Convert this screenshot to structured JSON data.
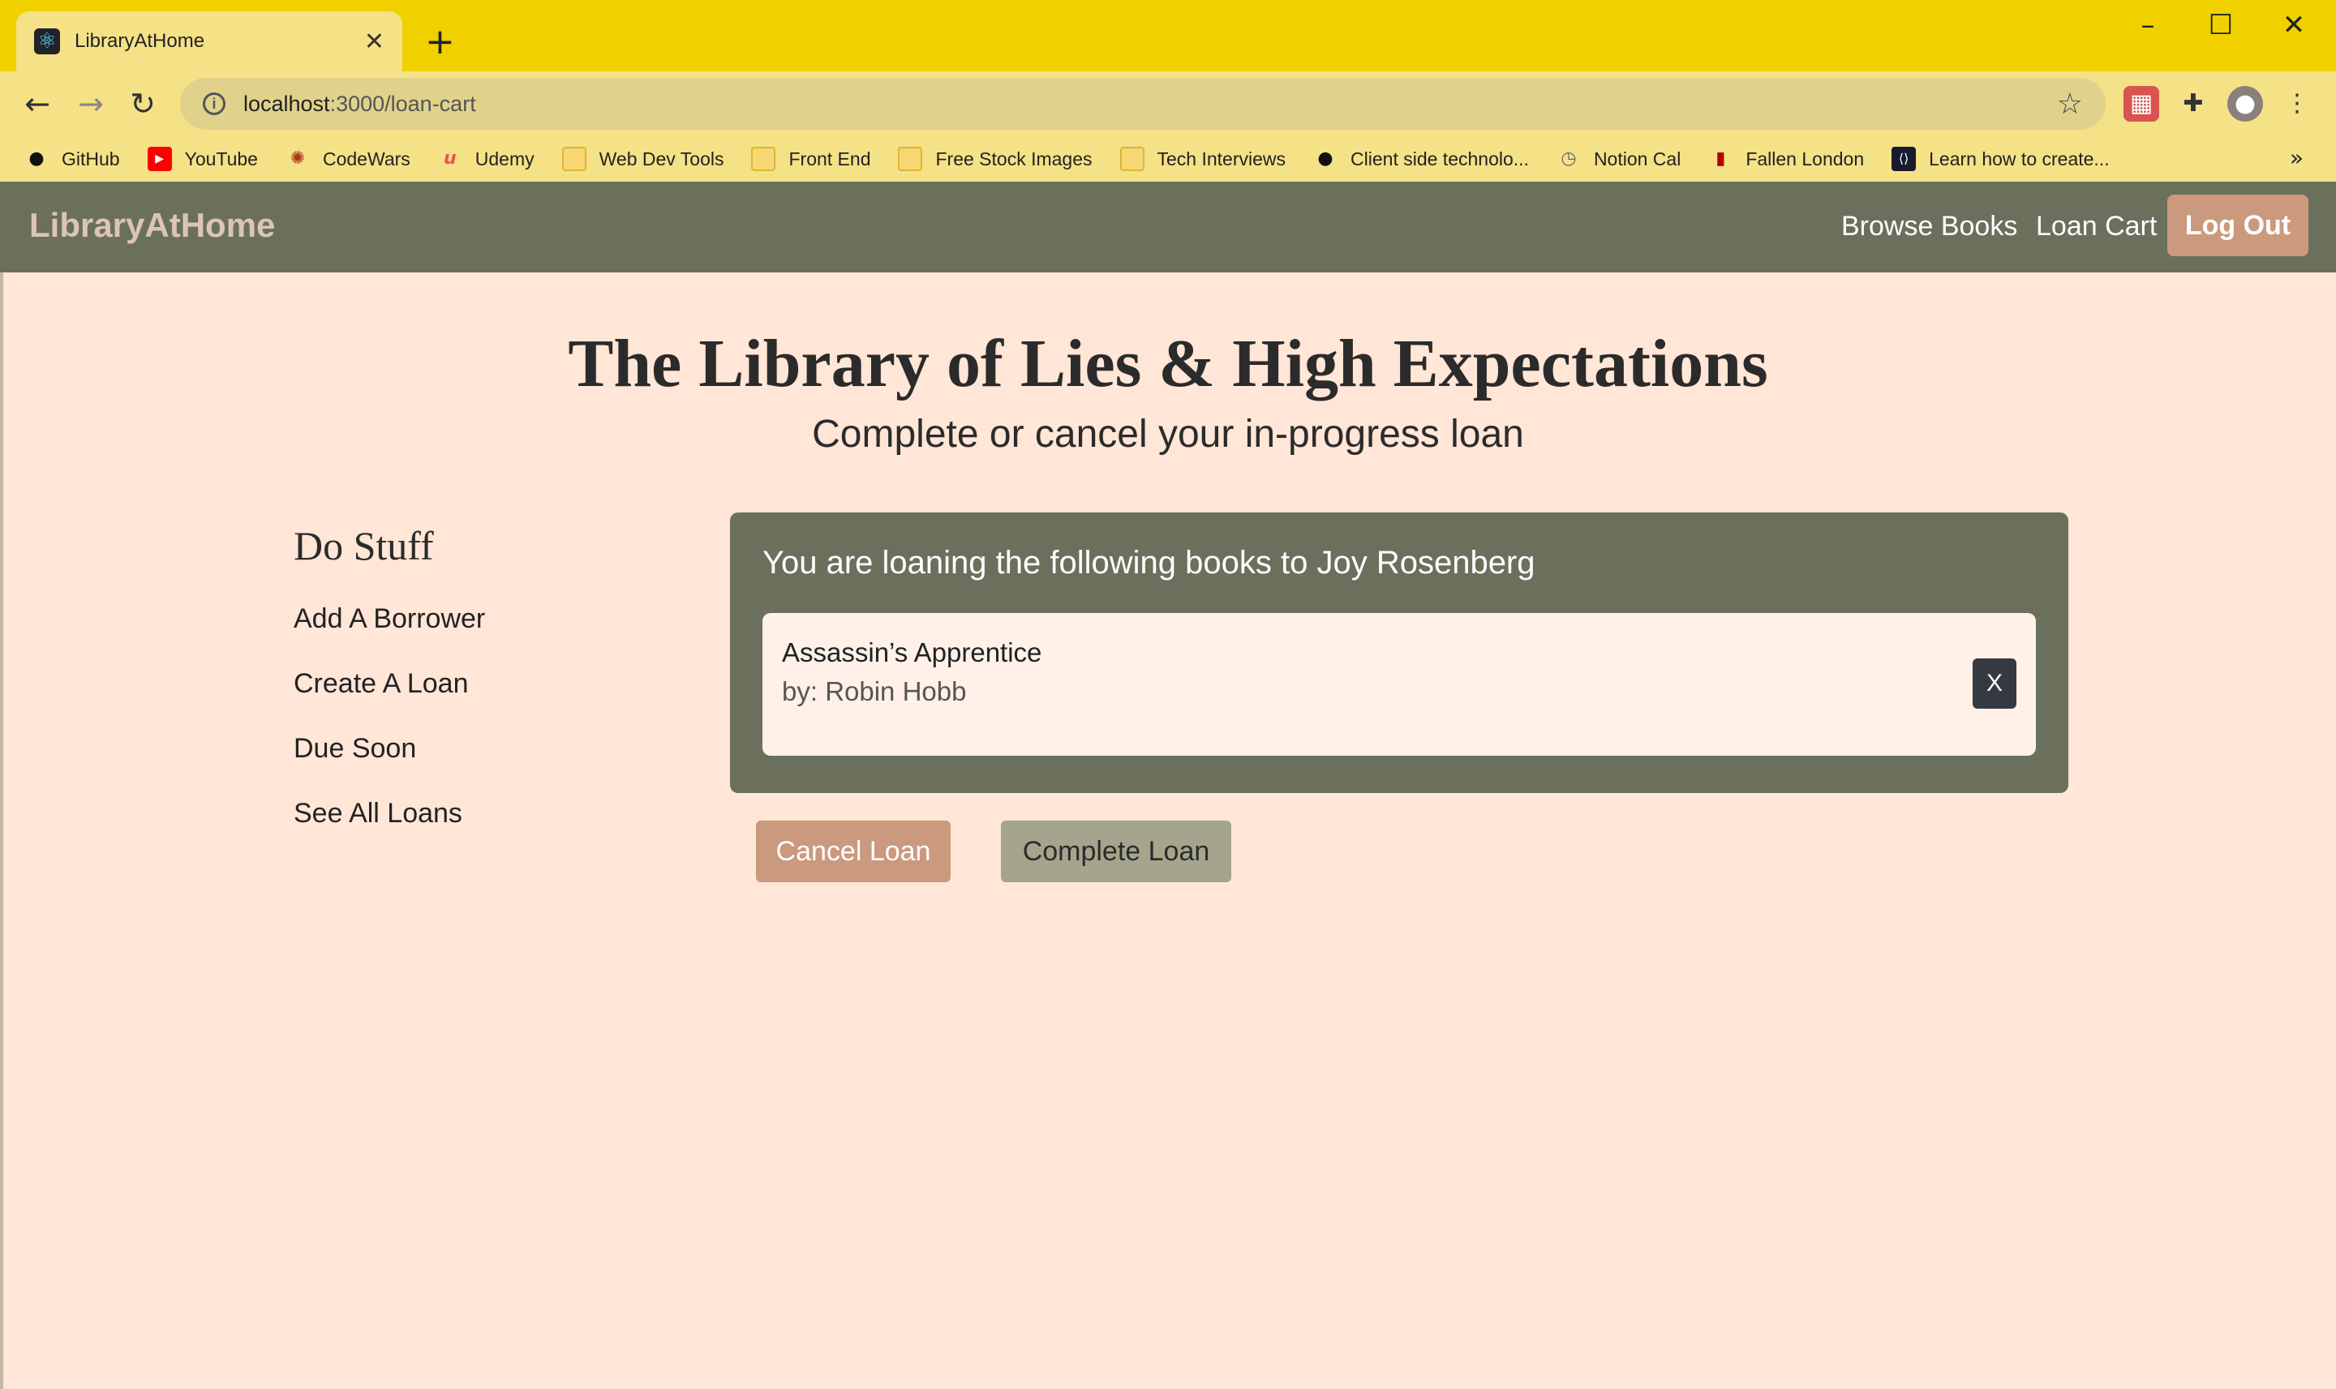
{
  "browser": {
    "tab_title": "LibraryAtHome",
    "url_host": "localhost",
    "url_path": ":3000/loan-cart",
    "bookmarks": [
      {
        "label": "GitHub",
        "icon": "github-icon"
      },
      {
        "label": "YouTube",
        "icon": "youtube-icon"
      },
      {
        "label": "CodeWars",
        "icon": "codewars-icon"
      },
      {
        "label": "Udemy",
        "icon": "udemy-icon"
      },
      {
        "label": "Web Dev Tools",
        "icon": "folder-icon"
      },
      {
        "label": "Front End",
        "icon": "folder-icon"
      },
      {
        "label": "Free Stock Images",
        "icon": "folder-icon"
      },
      {
        "label": "Tech Interviews",
        "icon": "folder-icon"
      },
      {
        "label": "Client side technolo...",
        "icon": "github-icon"
      },
      {
        "label": "Notion Cal",
        "icon": "clock-icon"
      },
      {
        "label": "Fallen London",
        "icon": "fallen-london-icon"
      },
      {
        "label": "Learn how to create...",
        "icon": "code-icon"
      }
    ]
  },
  "navbar": {
    "brand": "LibraryAtHome",
    "links": [
      "Browse Books",
      "Loan Cart"
    ],
    "logout_label": "Log Out"
  },
  "page": {
    "title": "The Library of Lies & High Expectations",
    "subtitle": "Complete or cancel your in-progress loan"
  },
  "sidebar": {
    "heading": "Do Stuff",
    "items": [
      "Add A Borrower",
      "Create A Loan",
      "Due Soon",
      "See All Loans"
    ]
  },
  "cart": {
    "heading": "You are loaning the following books to Joy Rosenberg",
    "books": [
      {
        "title": "Assassin’s Apprentice",
        "author": "by: Robin Hobb",
        "remove_label": "X"
      }
    ]
  },
  "actions": {
    "cancel_label": "Cancel Loan",
    "complete_label": "Complete Loan"
  },
  "colors": {
    "navbar": "#6b705c",
    "accent": "#cb997e",
    "secondary": "#a5a58d",
    "background": "#ffe6d7",
    "chrome": "#f1d000"
  }
}
